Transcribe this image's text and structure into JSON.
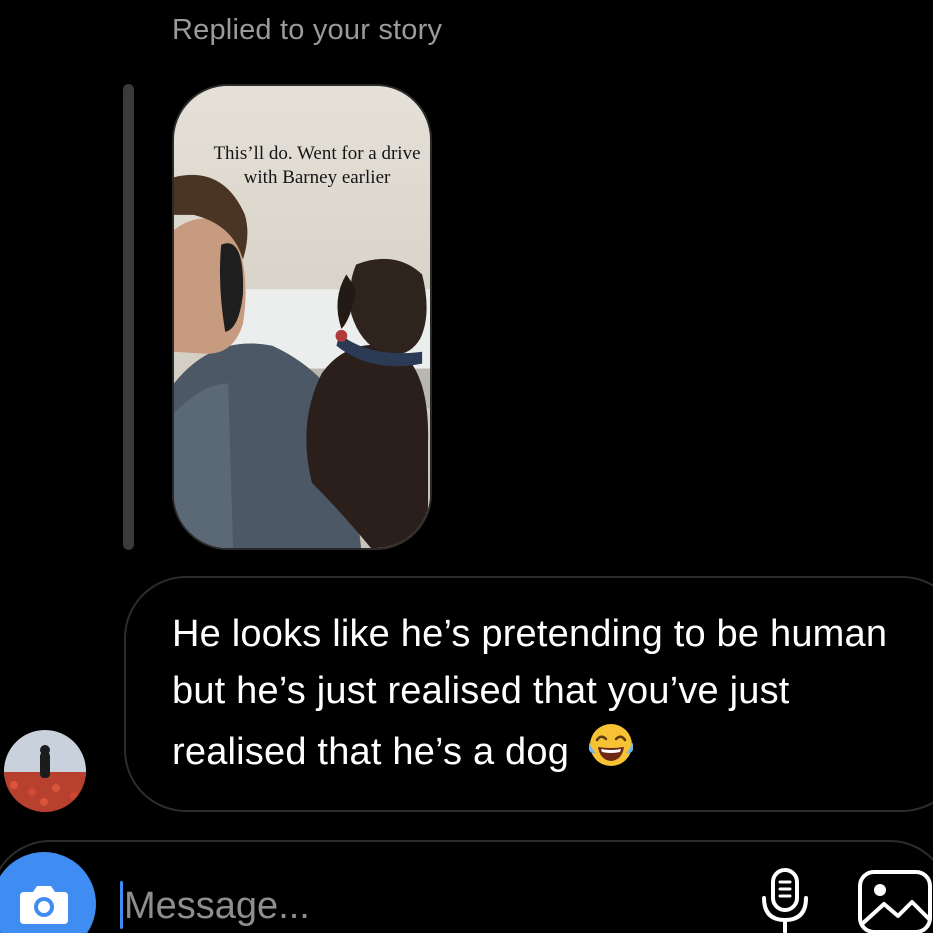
{
  "thread": {
    "reply_label": "Replied to your story",
    "story": {
      "caption": "This’ll do. Went for a drive with Barney earlier"
    },
    "message": {
      "text": "He looks like he’s pretending to be human but he’s just realised that you’ve just realised that he’s a dog",
      "emoji": "face-with-tears-of-joy"
    },
    "sender_avatar": "avatar-photo"
  },
  "composer": {
    "placeholder": "Message...",
    "camera_icon": "camera-icon",
    "mic_icon": "microphone-icon",
    "gallery_icon": "gallery-icon"
  },
  "colors": {
    "background": "#000000",
    "accent": "#3f8cf2",
    "muted_text": "#9a9a9a",
    "bubble_border": "#2c2c2c"
  }
}
